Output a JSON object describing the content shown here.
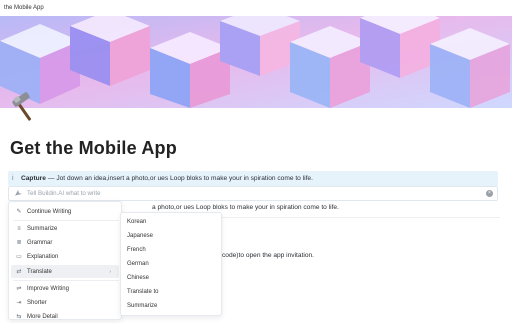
{
  "window": {
    "title": "the Mobile App"
  },
  "page": {
    "title": "Get the Mobile App",
    "callout": {
      "strong": "Capture",
      "text": " — Jot down an idea,insert a photo,or ues Loop bloks to make your in spiration come to life."
    },
    "line1": "a photo,or ues Loop bloks to make your in spiration come to life.",
    "line2": "code)to open the app invitation."
  },
  "ai_bar": {
    "placeholder": "Tell Buildin.AI what to write"
  },
  "menu": {
    "items": [
      {
        "label": "Continue Writing",
        "icon": "pen-icon"
      },
      {
        "label": "Summarize",
        "icon": "summarize-icon"
      },
      {
        "label": "Grammar",
        "icon": "grammar-icon"
      },
      {
        "label": "Explanation",
        "icon": "explanation-icon"
      },
      {
        "label": "Translate",
        "icon": "translate-icon"
      },
      {
        "label": "Improve Writing",
        "icon": "improve-icon"
      },
      {
        "label": "Shorter",
        "icon": "shorter-icon"
      },
      {
        "label": "More Detail",
        "icon": "more-detail-icon"
      }
    ]
  },
  "submenu": {
    "items": [
      {
        "label": "Korean"
      },
      {
        "label": "Japanese"
      },
      {
        "label": "French"
      },
      {
        "label": "German"
      },
      {
        "label": "Chinese"
      },
      {
        "label": "Translate to"
      },
      {
        "label": "Summarize"
      }
    ]
  },
  "colors": {
    "callout_bg": "#e7f3fb",
    "menu_active_bg": "#eef0f3",
    "banner_purple": "#b89af0",
    "banner_pink": "#f0a6d8",
    "banner_blue": "#8fa8f5"
  }
}
